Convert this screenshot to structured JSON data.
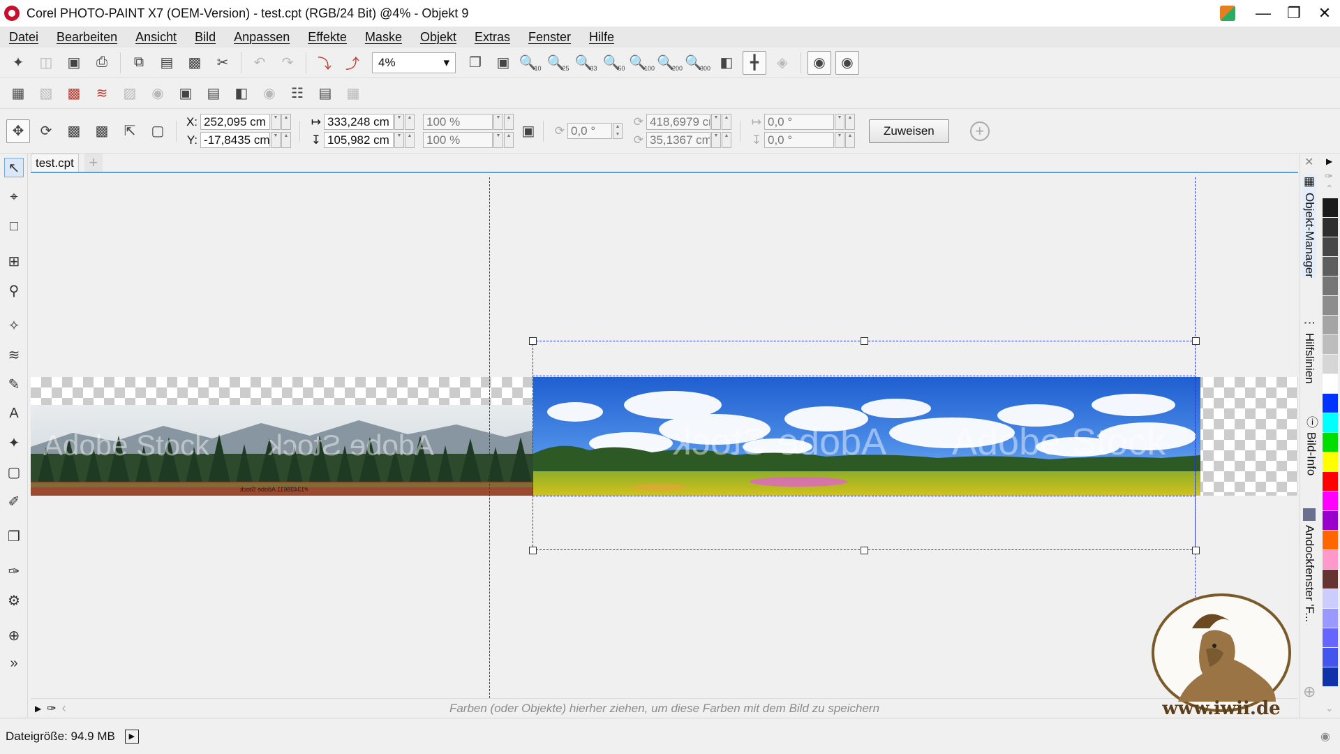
{
  "window": {
    "title": "Corel PHOTO-PAINT X7 (OEM-Version) - test.cpt (RGB/24 Bit) @4% - Objekt 9",
    "controls": [
      "minimize-icon",
      "maximize-icon",
      "close-icon"
    ]
  },
  "menu": [
    "Datei",
    "Bearbeiten",
    "Ansicht",
    "Bild",
    "Anpassen",
    "Effekte",
    "Maske",
    "Objekt",
    "Extras",
    "Fenster",
    "Hilfe"
  ],
  "toolbar": {
    "zoom_value": "4%",
    "zoom_levels": [
      "10",
      "25",
      "33",
      "50",
      "100",
      "200",
      "300"
    ]
  },
  "properties": {
    "x_label": "X:",
    "x_value": "252,095 cm",
    "y_label": "Y:",
    "y_value": "-17,8435 cm",
    "width_value": "333,248 cm",
    "height_value": "105,982 cm",
    "scale_w": "100 %",
    "scale_h": "100 %",
    "rotation": "0,0 °",
    "center_x": "418,6979 cr",
    "center_y": "35,1367 cm",
    "skew_h": "0,0 °",
    "skew_v": "0,0 °",
    "assign_button": "Zuweisen"
  },
  "document": {
    "tab_name": "test.cpt",
    "forest_watermark": "Adobe Stock",
    "forest_caption": "#13438611 Adobe Stock",
    "meadow_watermark": "Adobe Stock"
  },
  "palette_hint": "Farben (oder Objekte) hierher ziehen, um diese Farben mit dem Bild zu speichern",
  "dockers": [
    "Objekt-Manager",
    "Hilfslinien",
    "Bild-Info",
    "Andockfenster 'F..."
  ],
  "colors": [
    "#1a1a1a",
    "#2e2e2e",
    "#474747",
    "#5e5e5e",
    "#767676",
    "#8d8d8d",
    "#a5a5a5",
    "#bdbdbd",
    "#d6d6d6",
    "#ffffff",
    "#0033ff",
    "#00ffff",
    "#00dd00",
    "#ffff00",
    "#ff0000",
    "#ff00ff",
    "#9900cc",
    "#ff6600",
    "#ff99cc",
    "#663333",
    "#ccccff",
    "#9999ff",
    "#6666ff",
    "#4455ee",
    "#1133aa"
  ],
  "status": {
    "filesize": "Dateigröße: 94.9 MB"
  },
  "logo": {
    "text": "www.iwii.de"
  }
}
